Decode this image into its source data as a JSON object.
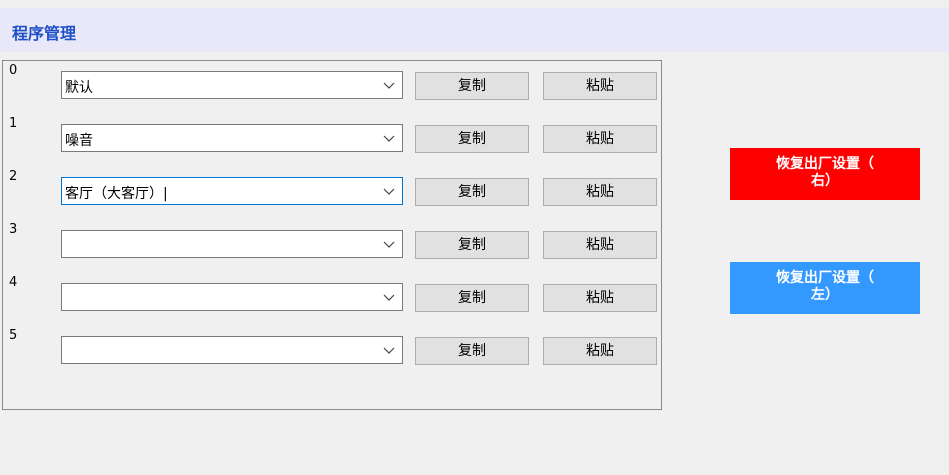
{
  "header": {
    "title": "程序管理"
  },
  "programs": [
    {
      "index": "0",
      "value": "默认"
    },
    {
      "index": "1",
      "value": "噪音"
    },
    {
      "index": "2",
      "value": "客厅（大客厅）|"
    },
    {
      "index": "3",
      "value": ""
    },
    {
      "index": "4",
      "value": ""
    },
    {
      "index": "5",
      "value": ""
    }
  ],
  "buttons": {
    "copy_label": "复制",
    "paste_label": "粘贴"
  },
  "factory_reset": {
    "right_line1": "恢复出厂设置（",
    "right_line2": "右）",
    "left_line1": "恢复出厂设置（",
    "left_line2": "左）"
  },
  "colors": {
    "right_button": "#ff0000",
    "left_button": "#3399ff",
    "title": "#2050c8",
    "header_bg": "#e8e8f8"
  },
  "icons": {
    "dropdown": "chevron-down-icon"
  }
}
